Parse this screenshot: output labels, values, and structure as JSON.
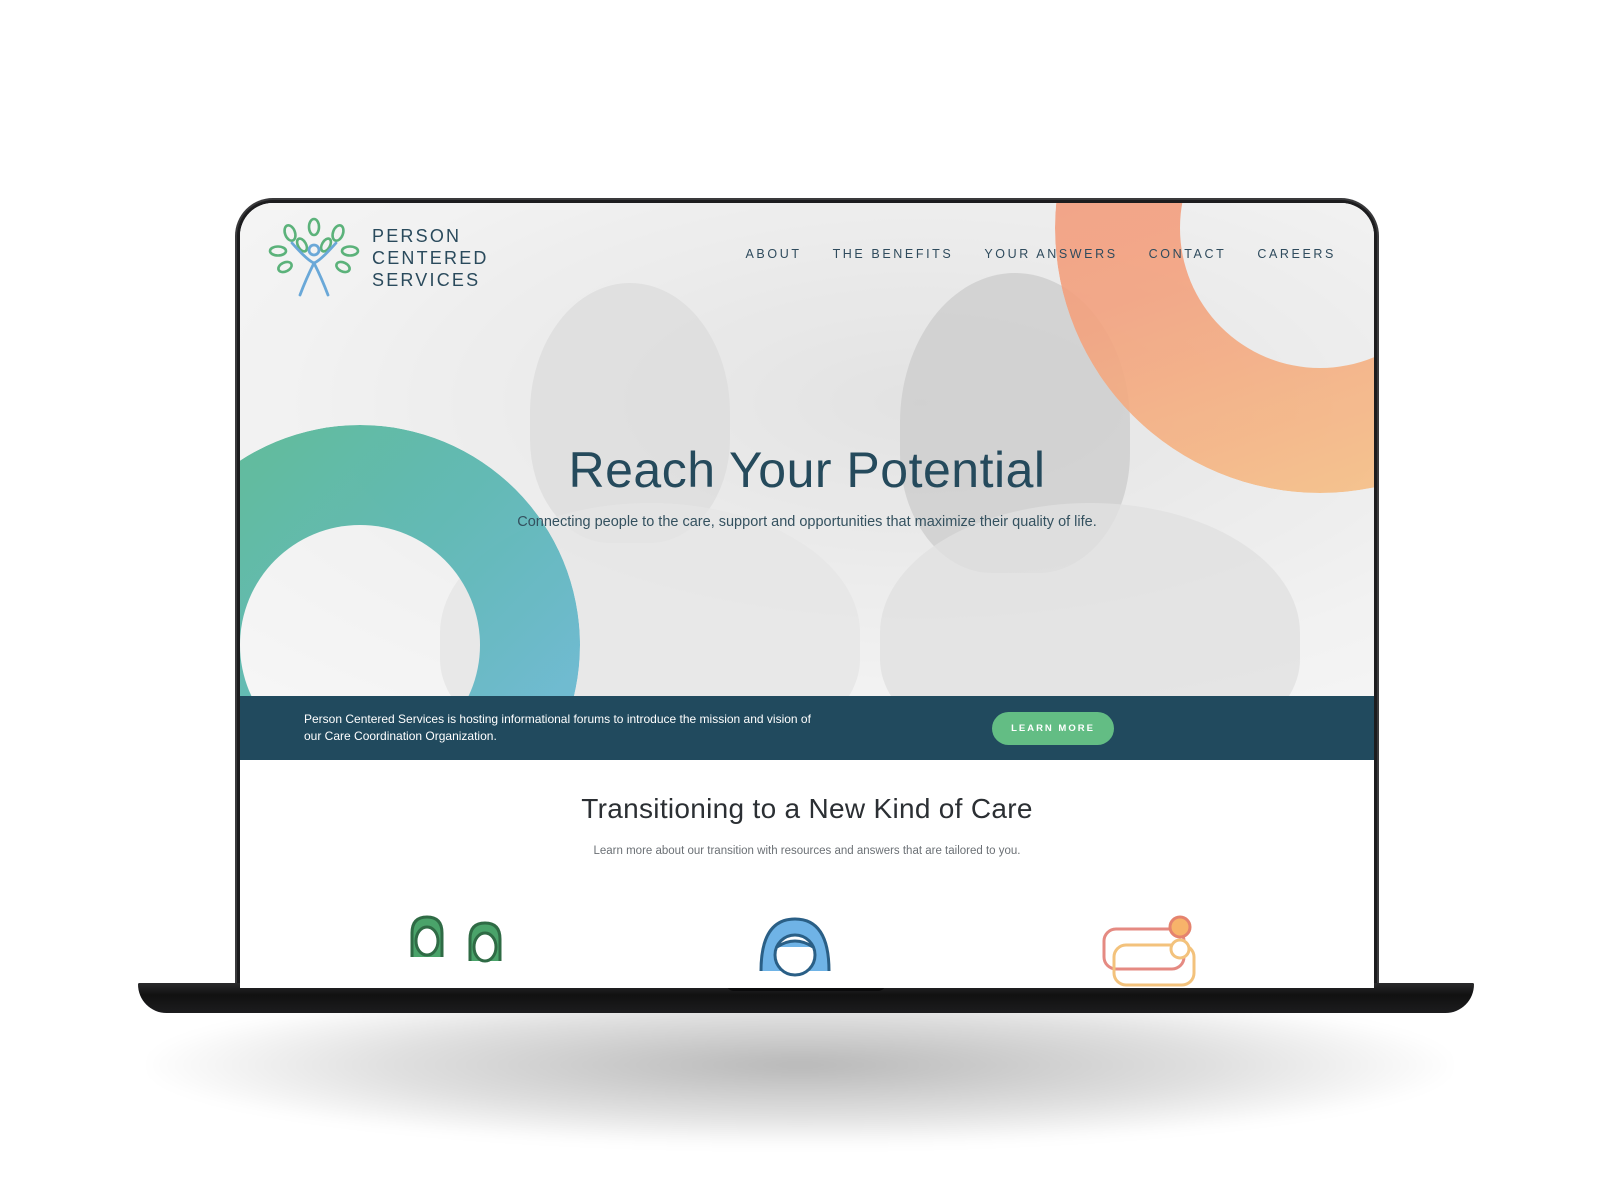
{
  "logo": {
    "line1": "PERSON",
    "line2": "CENTERED",
    "line3": "SERVICES",
    "icon": "tree-person-icon"
  },
  "nav": {
    "items": [
      {
        "label": "ABOUT"
      },
      {
        "label": "THE BENEFITS"
      },
      {
        "label": "YOUR ANSWERS"
      },
      {
        "label": "CONTACT"
      },
      {
        "label": "CAREERS"
      }
    ]
  },
  "hero": {
    "title": "Reach Your Potential",
    "subtitle": "Connecting people to the care, support and opportunities that maximize their quality of life."
  },
  "banner": {
    "text": "Person Centered Services is hosting informational forums to introduce the mission and vision of our Care Coordination Organization.",
    "button_label": "LEARN MORE"
  },
  "section": {
    "title": "Transitioning to a New Kind of Care",
    "subtitle": "Learn more about our transition with resources and answers that are tailored to you.",
    "icons": [
      "two-people-icon",
      "person-icon",
      "chat-bubbles-icon"
    ]
  },
  "colors": {
    "primary_navy": "#214a5e",
    "accent_green": "#63bd84",
    "ring_green_start": "#54b88a",
    "ring_blue_end": "#6fb9e3",
    "ring_orange_start": "#f29078",
    "ring_yellow_end": "#f7c585",
    "logo_leaf_green": "#5bb27a",
    "logo_figure_blue": "#6aa8d8"
  }
}
